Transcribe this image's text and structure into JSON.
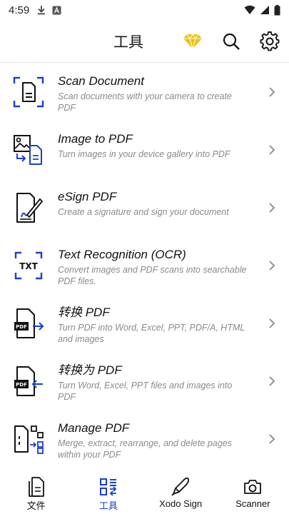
{
  "status_bar": {
    "time": "4:59"
  },
  "app_bar": {
    "title": "工具",
    "icons": [
      "premium-diamond-icon",
      "search-icon",
      "settings-gear-icon"
    ]
  },
  "tools": [
    {
      "title": "Scan Document",
      "desc": "Scan documents with your camera to create PDF",
      "icon": "scan-document-icon"
    },
    {
      "title": "Image to PDF",
      "desc": "Turn images in your device gallery into PDF",
      "icon": "image-to-pdf-icon"
    },
    {
      "title": "eSign PDF",
      "desc": "Create a signature and sign your document",
      "icon": "esign-icon"
    },
    {
      "title": "Text Recognition (OCR)",
      "desc": "Convert images and PDF scans into searchable PDF files.",
      "icon": "ocr-txt-icon"
    },
    {
      "title": "转换 PDF",
      "desc": "Turn PDF into Word, Excel, PPT, PDF/A, HTML and images",
      "icon": "convert-from-pdf-icon"
    },
    {
      "title": "转换为 PDF",
      "desc": "Turn Word, Excel, PPT files and images into PDF",
      "icon": "convert-to-pdf-icon"
    },
    {
      "title": "Manage PDF",
      "desc": "Merge, extract, rearrange, and delete pages within your PDF",
      "icon": "manage-pdf-icon"
    }
  ],
  "bottom_nav": [
    {
      "label": "文件",
      "icon": "files-icon",
      "active": false
    },
    {
      "label": "工具",
      "icon": "tools-icon",
      "active": true
    },
    {
      "label": "Xodo Sign",
      "icon": "xodo-sign-pen-icon",
      "active": false
    },
    {
      "label": "Scanner",
      "icon": "camera-icon",
      "active": false
    }
  ],
  "colors": {
    "accent": "#1a3ed1",
    "premium": "#f2c200",
    "text_secondary": "#8a8a8a"
  }
}
